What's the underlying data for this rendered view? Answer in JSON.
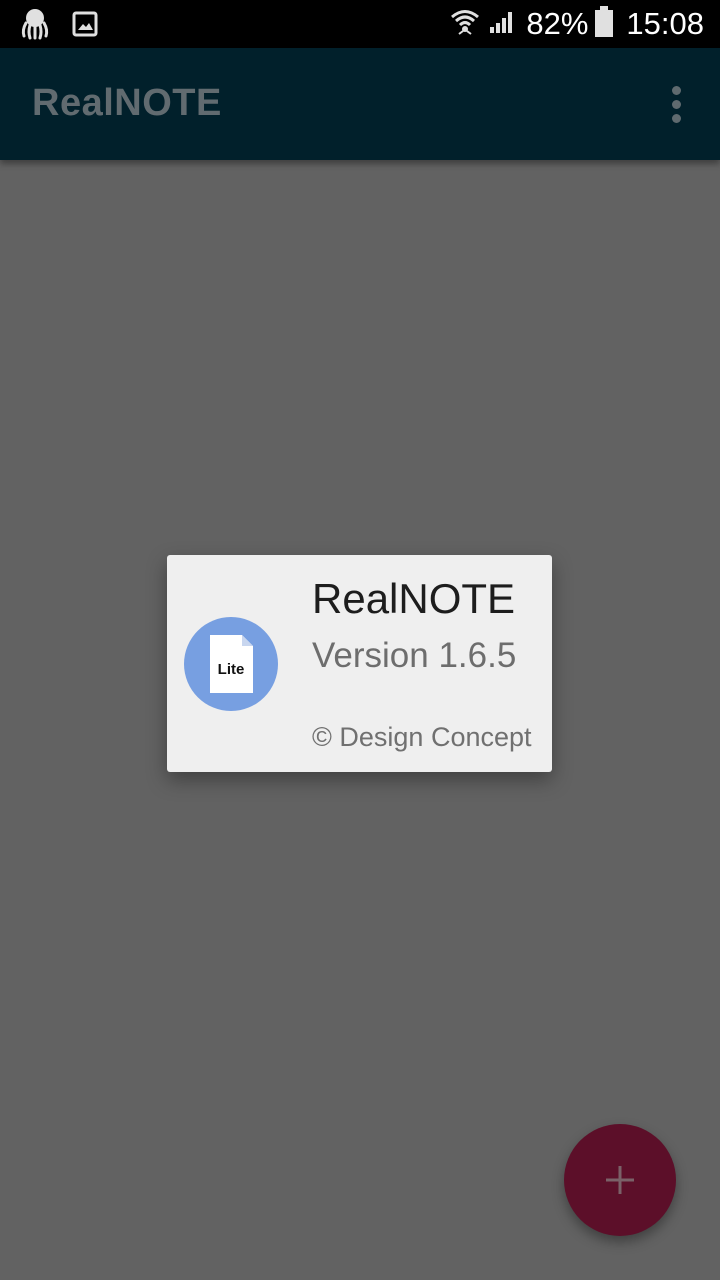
{
  "status_bar": {
    "left_icons": [
      "octopus-icon",
      "image-icon"
    ],
    "right_icons": [
      "wifi-icon",
      "signal-icon",
      "battery-icon"
    ],
    "battery_percent": "82%",
    "time": "15:08"
  },
  "toolbar": {
    "title": "RealNOTE",
    "overflow_icon": "more-vert-icon"
  },
  "about_dialog": {
    "logo_label": "Lite",
    "app_name": "RealNOTE",
    "version": "Version 1.6.5",
    "copyright": "© Design Concept"
  },
  "fab": {
    "icon": "plus-icon"
  },
  "colors": {
    "toolbar_bg": "#01202b",
    "scrim_bg": "#626262",
    "dialog_bg": "#efefef",
    "logo_circle": "#779fe1",
    "fab_bg": "#5c0f29"
  }
}
